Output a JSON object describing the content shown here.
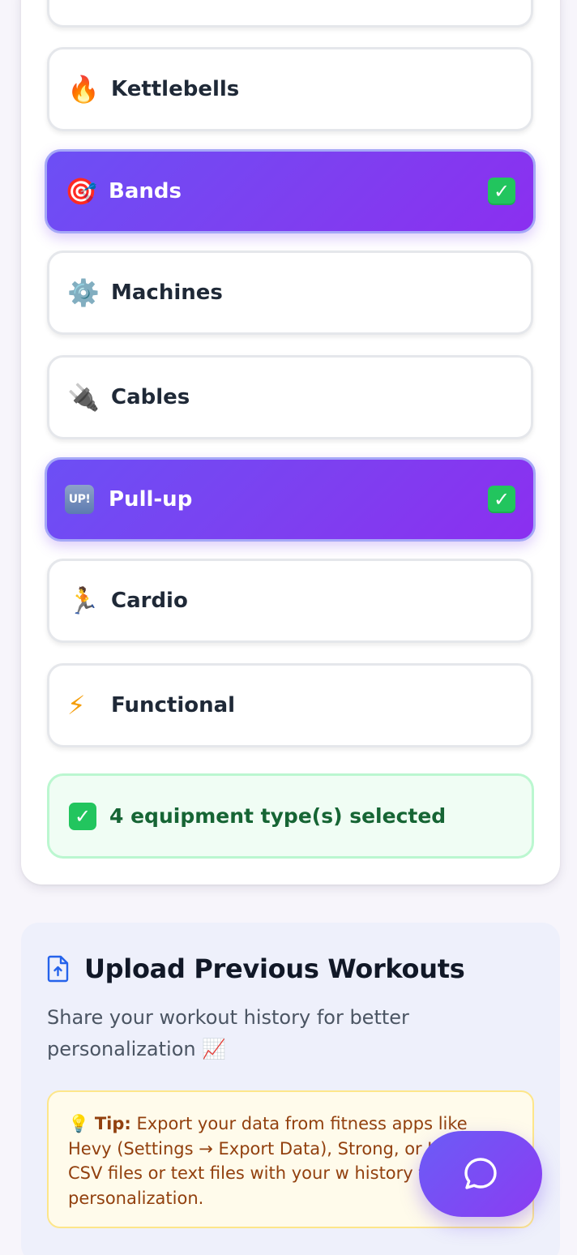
{
  "equipment": {
    "options": [
      {
        "icon": "fire-icon",
        "emoji": "🔥",
        "label": "Kettlebells",
        "selected": false
      },
      {
        "icon": "target-icon",
        "emoji": "🎯",
        "label": "Bands",
        "selected": true
      },
      {
        "icon": "gear-icon",
        "emoji": "⚙️",
        "label": "Machines",
        "selected": false
      },
      {
        "icon": "plug-icon",
        "emoji": "🔌",
        "label": "Cables",
        "selected": false
      },
      {
        "icon": "up-badge-icon",
        "emoji": "UP!",
        "label": "Pull-up",
        "selected": true
      },
      {
        "icon": "runner-icon",
        "emoji": "🏃",
        "label": "Cardio",
        "selected": false
      },
      {
        "icon": "lightning-icon",
        "emoji": "⚡",
        "label": "Functional",
        "selected": false
      }
    ],
    "check_mark": "✓",
    "summary": "4 equipment type(s) selected"
  },
  "upload": {
    "title": "Upload Previous Workouts",
    "subtitle": "Share your workout history for better personalization 📈",
    "tip_label": "Tip:",
    "tip_text": "Export your data from fitness apps like Hevy (Settings → Export Data), Strong, or Upload CSV files or text files with your w history for better personalization.",
    "tip_icon": "💡"
  },
  "colors": {
    "accent_start": "#6c4ff5",
    "accent_end": "#8b2ff0",
    "success": "#22c55e",
    "summary_text": "#166534",
    "tip_text": "#92400e"
  }
}
